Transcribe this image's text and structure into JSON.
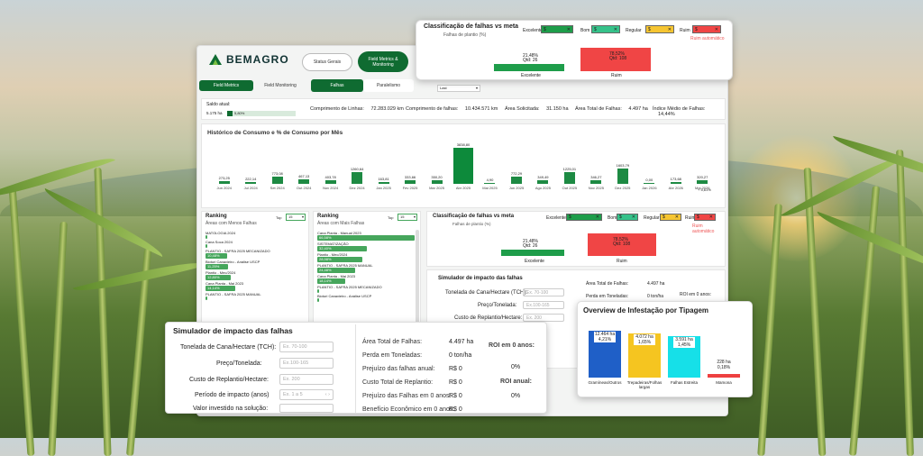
{
  "brand": {
    "name": "BEMAGRO"
  },
  "nav": {
    "status": "Status Gerais",
    "field_metrics": "Field Metrics & Monitoring",
    "sub_tabs": [
      "Field Metrics",
      "Field Monitoring"
    ],
    "falhas": "Falhas",
    "paralelismo": "Paralelismo",
    "select_value": "Last"
  },
  "saldo": {
    "label": "Saldo atual:",
    "value": "5.175 ha",
    "pct": "5,80%"
  },
  "kpis": [
    {
      "label": "Comprimento de Linhas:",
      "value": "72.283.029 km"
    },
    {
      "label": "Comprimento de falhas:",
      "value": "10.434.571 km"
    },
    {
      "label": "Área Solicitada:",
      "value": "31.150 ha"
    },
    {
      "label": "Área Total de Falhas:",
      "value": "4.497 ha"
    },
    {
      "label": "Índice Médio de Falhas:",
      "value": "14,44%"
    }
  ],
  "history": {
    "title": "Histórico de Consumo e % de Consumo por Mês",
    "bars": [
      {
        "label": "Jun 2024",
        "value": "273,25",
        "h": 0.08
      },
      {
        "label": "Jul 2024",
        "value": "222,14",
        "h": 0.06
      },
      {
        "label": "Set 2024",
        "value": "773,08",
        "h": 0.21
      },
      {
        "label": "Out 2024",
        "value": "467,13",
        "h": 0.13
      },
      {
        "label": "Nov 2024",
        "value": "403,78",
        "h": 0.11
      },
      {
        "label": "Dez 2024",
        "value": "1260,64",
        "h": 0.33
      },
      {
        "label": "Jan 2025",
        "value": "163,81",
        "h": 0.05
      },
      {
        "label": "Fev 2025",
        "value": "333,66",
        "h": 0.09
      },
      {
        "label": "Mar 2025",
        "value": "350,20",
        "h": 0.1
      },
      {
        "label": "Abr 2025",
        "value": "3838,80",
        "h": 1.0
      },
      {
        "label": "Mai 2025",
        "value": "4,90",
        "h": 0.005
      },
      {
        "label": "Jun 2025",
        "value": "772,29",
        "h": 0.21
      },
      {
        "label": "Ago 2025",
        "value": "349,49",
        "h": 0.09
      },
      {
        "label": "Out 2025",
        "value": "1225,01",
        "h": 0.32
      },
      {
        "label": "Nov 2025",
        "value": "346,27",
        "h": 0.09
      },
      {
        "label": "Dez 2025",
        "value": "1603,79",
        "h": 0.42
      },
      {
        "label": "Jan 2026",
        "value": "0,00",
        "h": 0.0
      },
      {
        "label": "Abr 2026",
        "value": "173,68",
        "h": 0.05
      },
      {
        "label": "Mai 2026",
        "value": "320,27",
        "h": 0.09
      }
    ],
    "last_extra": "+ 5,61%"
  },
  "ranking_left": {
    "title": "Ranking",
    "subtitle": "Áreas com Menos Falhas",
    "top_label": "Top",
    "top_value": "15",
    "rows": [
      {
        "label": "MATOLOGIA 2024",
        "value": "",
        "w": 0.0
      },
      {
        "label": "Cana Soca 2024",
        "value": "",
        "w": 0.0
      },
      {
        "label": "PLANTIO - SAFRA 2025 MECANIZADO",
        "value": "10,48%",
        "w": 0.22
      },
      {
        "label": "Bioturi Canavieiro - Análise USCP",
        "value": "11,25%",
        "w": 0.23
      },
      {
        "label": "Plantio - Mec/2024",
        "value": "12,80%",
        "w": 0.25
      },
      {
        "label": "Cana Planta - Mai 2023",
        "value": "14,14%",
        "w": 0.3
      },
      {
        "label": "PLANTIO - SAFRA 2025 MANUAL",
        "value": "",
        "w": 0.0
      }
    ]
  },
  "ranking_right": {
    "title": "Ranking",
    "subtitle": "Áreas com Mais Falhas",
    "top_label": "Top",
    "top_value": "15",
    "rows": [
      {
        "label": "Cana Planta - Manual 2023",
        "value": "66,58%",
        "w": 0.98
      },
      {
        "label": "SISTEMATIZAÇÃO",
        "value": "32,40%",
        "w": 0.5
      },
      {
        "label": "Plantio - Mec/2024",
        "value": "28,98%",
        "w": 0.45
      },
      {
        "label": "PLANTIO - SAFRA 2025 MANUAL",
        "value": "24,48%",
        "w": 0.38
      },
      {
        "label": "Cana Planta - Mai 2023",
        "value": "18,14%",
        "w": 0.28
      },
      {
        "label": "PLANTIO - SAFRA 2025 MECANIZADO",
        "value": "",
        "w": 0.0
      },
      {
        "label": "Bioturi Canavieiro - Análise USCP",
        "value": "",
        "w": 0.0
      }
    ]
  },
  "classificacao": {
    "title": "Classificação de falhas vs meta",
    "subtitle": "Falhas de plantio (%)",
    "legend": [
      {
        "label": "Excelente",
        "color": "#1e9d4a"
      },
      {
        "label": "Bom",
        "color": "#36c28a"
      },
      {
        "label": "Regular",
        "color": "#f6c531"
      },
      {
        "label": "Ruim",
        "color": "#f04545"
      }
    ],
    "note": "Ruim automático",
    "excelente": {
      "pct": "21,48%",
      "qtd": "Qtd: 26",
      "name": "Excelente"
    },
    "ruim": {
      "pct": "78,52%",
      "qtd": "Qtd: 108",
      "name": "Ruim"
    }
  },
  "simulador": {
    "title": "Simulador de impacto das falhas",
    "fields": [
      {
        "label": "Tonelada de Cana/Hectare (TCH):",
        "placeholder": "Ex. 70-100"
      },
      {
        "label": "Preço/Tonelada:",
        "placeholder": "Ex.100-165"
      },
      {
        "label": "Custo de Replantio/Hectare:",
        "placeholder": "Ex. 200"
      },
      {
        "label": "Período de impacto (anos)",
        "placeholder": "Ex. 1 a 5"
      },
      {
        "label": "Valor investido na solução:",
        "placeholder": ""
      }
    ],
    "results": [
      {
        "label": "Área Total de Falhas:",
        "value": "4.497 ha"
      },
      {
        "label": "Perda em Toneladas:",
        "value": "0 ton/ha"
      },
      {
        "label": "Prejuízo das falhas anual:",
        "value": "R$ 0"
      },
      {
        "label": "Custo Total de Replantio:",
        "value": "R$ 0"
      },
      {
        "label": "Prejuízo das Falhas em 0 anos:",
        "value": "R$ 0"
      },
      {
        "label": "Benefício Econômico em 0 anos:",
        "value": "R$ 0"
      }
    ],
    "roi0_label": "ROI em 0 anos:",
    "roi0_value": "0%",
    "roi_annual_label": "ROI anual:",
    "roi_annual_value": "0%"
  },
  "infestacao": {
    "title": "Overview de Infestação por Tipagem",
    "bars": [
      {
        "name": "Gramíneas/Outros",
        "ha": "12.464 ha",
        "pct": "4,21%",
        "color": "#1f5fc7",
        "h": 1.0
      },
      {
        "name": "Trepadeiras/Folhas largas",
        "ha": "4.072 ha",
        "pct": "1,65%",
        "color": "#f5c520",
        "h": 0.94
      },
      {
        "name": "Falhas Estreita",
        "ha": "3.591 ha",
        "pct": "1,45%",
        "color": "#16e0e8",
        "h": 0.88
      },
      {
        "name": "Mamona",
        "ha": "228 ha",
        "pct": "0,18%",
        "color": "#ee4040",
        "h": 0.06
      }
    ]
  }
}
